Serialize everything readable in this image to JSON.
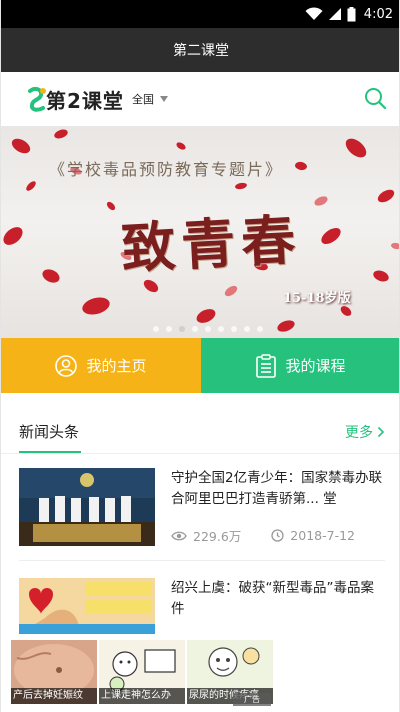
{
  "status_bar": {
    "time": "4:02"
  },
  "app_title": "第二课堂",
  "header": {
    "logo_text": "第2课堂",
    "region": "全国"
  },
  "banner": {
    "caption": "《学校毒品预防教育专题片》",
    "title": "致青春",
    "age_label": "15-18岁版",
    "dot_count": 9,
    "active_dot": 2
  },
  "actions": {
    "home_label": "我的主页",
    "course_label": "我的课程"
  },
  "news": {
    "section_title": "新闻头条",
    "more_label": "更多",
    "items": [
      {
        "title": "守护全国2亿青少年：国家禁毒办联合阿里巴巴打造青骄第... 堂",
        "views": "229.6万",
        "date": "2018-7-12"
      },
      {
        "title": "绍兴上虞：破获“新型毒品”毒品案件",
        "views": "",
        "date": ""
      }
    ]
  },
  "ads": {
    "items": [
      {
        "caption": "产后去掉妊娠纹"
      },
      {
        "caption": "上课走神怎么办"
      },
      {
        "caption": "尿尿的时候疼痛"
      }
    ],
    "badge": "广告"
  },
  "colors": {
    "accent_green": "#27c17e",
    "accent_yellow": "#f6b318",
    "title_bar": "#2d2d2d"
  }
}
